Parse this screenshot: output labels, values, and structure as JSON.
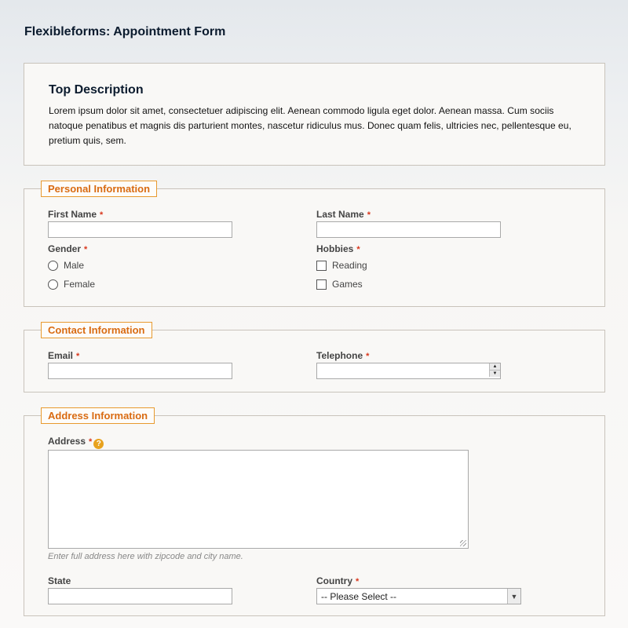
{
  "page": {
    "title": "Flexibleforms: Appointment Form"
  },
  "top": {
    "title": "Top Description",
    "text": "Lorem ipsum dolor sit amet, consectetuer adipiscing elit. Aenean commodo ligula eget dolor. Aenean massa. Cum sociis natoque penatibus et magnis dis parturient montes, nascetur ridiculus mus. Donec quam felis, ultricies nec, pellentesque eu, pretium quis, sem."
  },
  "personal": {
    "legend": "Personal Information",
    "first_name": {
      "label": "First Name",
      "value": ""
    },
    "last_name": {
      "label": "Last Name",
      "value": ""
    },
    "gender": {
      "label": "Gender",
      "options": [
        "Male",
        "Female"
      ]
    },
    "hobbies": {
      "label": "Hobbies",
      "options": [
        "Reading",
        "Games"
      ]
    }
  },
  "contact": {
    "legend": "Contact Information",
    "email": {
      "label": "Email",
      "value": ""
    },
    "telephone": {
      "label": "Telephone",
      "value": ""
    }
  },
  "address": {
    "legend": "Address Information",
    "address": {
      "label": "Address",
      "value": "",
      "hint": "Enter full address here with zipcode and city name.",
      "help": "?"
    },
    "state": {
      "label": "State",
      "value": ""
    },
    "country": {
      "label": "Country",
      "selected": "-- Please Select --"
    }
  },
  "required_mark": "*",
  "colors": {
    "accent": "#d96b12",
    "required": "#d9361b",
    "legend_border": "#e89a2f"
  }
}
